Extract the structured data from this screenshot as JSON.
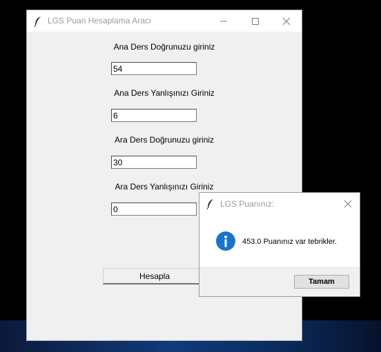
{
  "main_window": {
    "title": "LGS Puan Hesaplama Aracı",
    "fields": [
      {
        "label": "Ana Ders Doğrunuzu giriniz",
        "value": "54"
      },
      {
        "label": "Ana Ders Yanlışınızı Giriniz",
        "value": "6"
      },
      {
        "label": "Ara Ders Doğrunuzu giriniz",
        "value": "30"
      },
      {
        "label": "Ara Ders Yanlışınızı Giriniz",
        "value": "0"
      }
    ],
    "button_label": "Hesapla"
  },
  "dialog": {
    "title": "LGS Puanınız:",
    "message": "453.0 Puanınız var tebrikler.",
    "ok_label": "Tamam"
  },
  "colors": {
    "info_blue": "#1a73c8",
    "title_text": "#9a9a9a",
    "window_bg": "#f0f0f0"
  },
  "icons": {
    "app_icon": "feather-icon",
    "dialog_icon": "info-icon"
  }
}
